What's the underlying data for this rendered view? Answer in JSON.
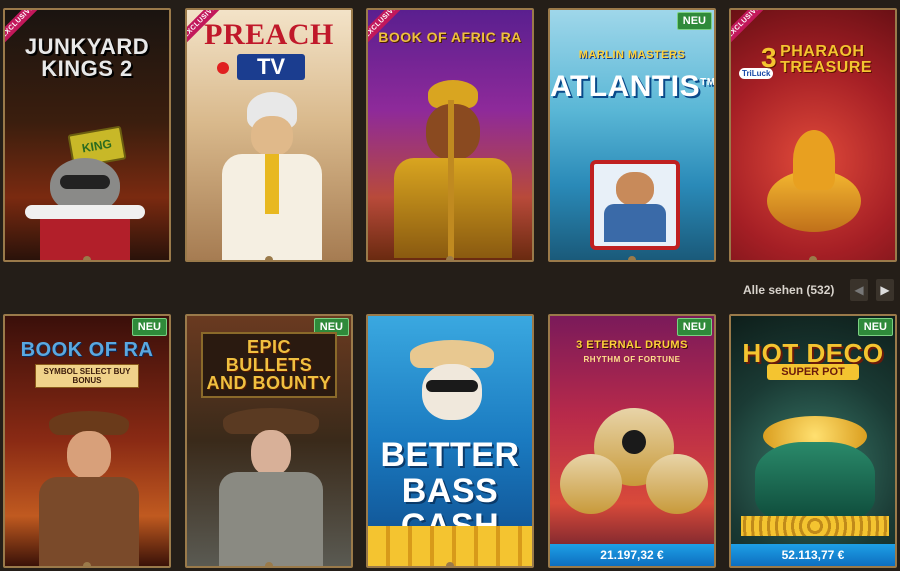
{
  "row1": [
    {
      "title": "JUNKYARD KINGS 2",
      "badge_exclusive": "EXCLUSIVE",
      "hat_text": "KING"
    },
    {
      "title": "PREACH",
      "subtitle": "TV",
      "badge_exclusive": "EXCLUSIVE"
    },
    {
      "title": "BOOK OF AFRIC RA",
      "badge_exclusive": "EXCLUSIVE"
    },
    {
      "title_top": "MARLIN MASTERS",
      "title": "ATLANTIS",
      "tm": "TM",
      "badge_new": "NEU"
    },
    {
      "brand": "TriLuck",
      "title_num": "3",
      "title": "PHARAOH TREASURE",
      "badge_exclusive": "EXCLUSIVE"
    }
  ],
  "see_all": {
    "label": "Alle sehen (532)"
  },
  "nav": {
    "prev_icon": "chevron-left-icon",
    "next_icon": "chevron-right-icon",
    "prev": "◀",
    "next": "▶"
  },
  "row2": [
    {
      "title": "BOOK OF RA",
      "subtitle": "SYMBOL SELECT BUY BONUS",
      "badge_new": "NEU"
    },
    {
      "title": "EPIC BULLETS AND BOUNTY",
      "badge_new": "NEU"
    },
    {
      "title": "BETTER BASS CASH"
    },
    {
      "title": "3 ETERNAL DRUMS",
      "subtitle": "RHYTHM OF FORTUNE",
      "badge_new": "NEU",
      "jackpot": "21.197,32 €"
    },
    {
      "title": "HOT DECO",
      "subtitle": "SUPER POT",
      "badge_new": "NEU",
      "jackpot": "52.113,77 €"
    }
  ]
}
